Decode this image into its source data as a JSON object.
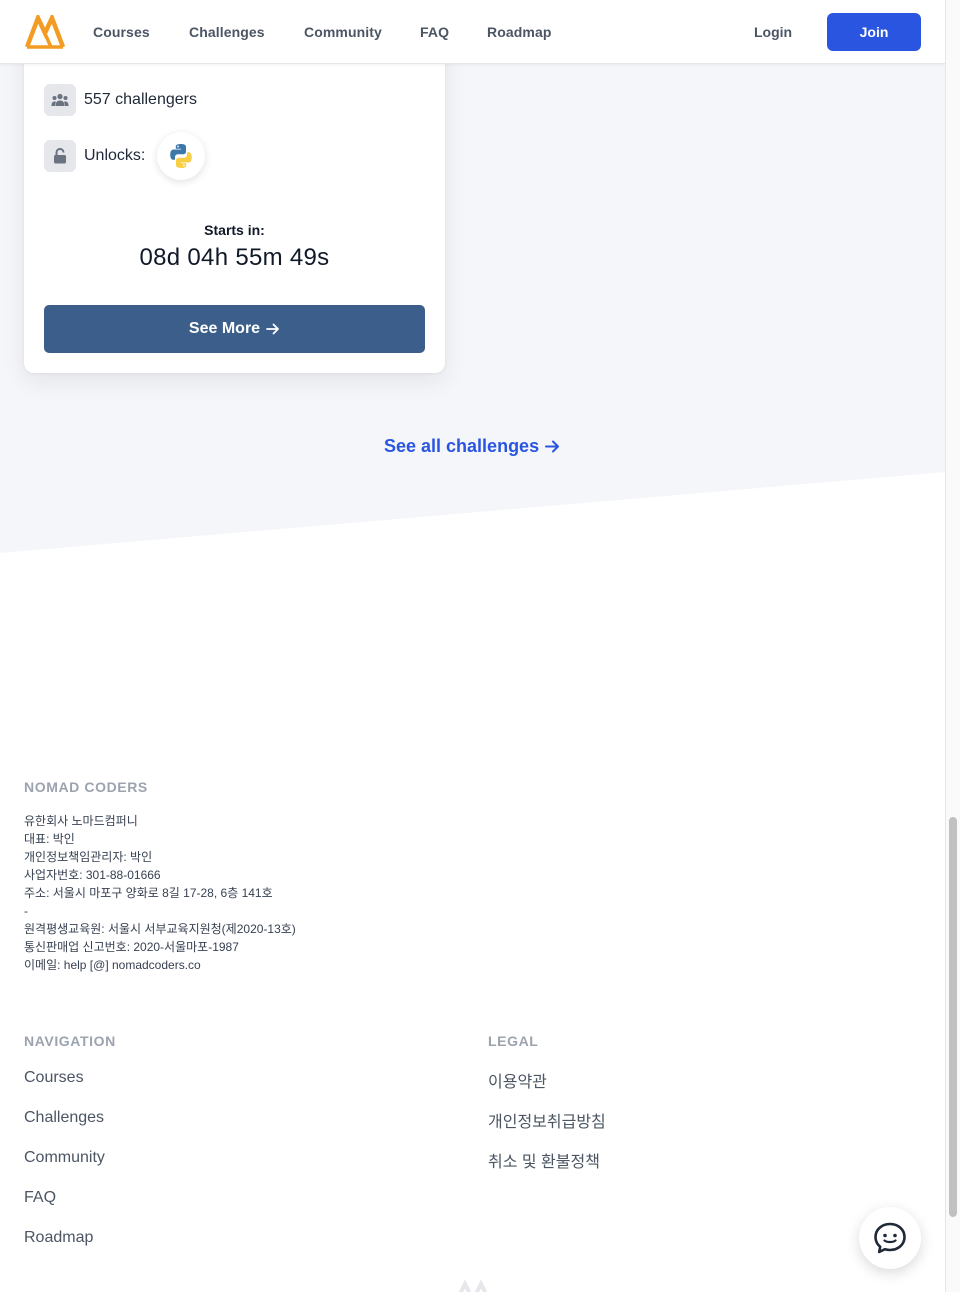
{
  "header": {
    "nav": [
      "Courses",
      "Challenges",
      "Community",
      "FAQ",
      "Roadmap"
    ],
    "login_label": "Login",
    "join_label": "Join"
  },
  "card": {
    "challengers": "557 challengers",
    "unlocks_label": "Unlocks:",
    "starts_label": "Starts in:",
    "countdown": "08d 04h 55m 49s",
    "see_more_label": "See More"
  },
  "see_all_label": "See all challenges",
  "footer": {
    "brand_title": "NOMAD CODERS",
    "company_lines": [
      "유한회사 노마드컴퍼니",
      "대표: 박인",
      "개인정보책임관리자: 박인",
      "사업자번호: 301-88-01666",
      "주소: 서울시 마포구 양화로 8길 17-28, 6층 141호",
      "-",
      "원격평생교육원: 서울시 서부교육지원청(제2020-13호)",
      "통신판매업 신고번호: 2020-서울마포-1987",
      "이메일: help [@] nomadcoders.co"
    ],
    "navigation_title": "NAVIGATION",
    "navigation_links": [
      "Courses",
      "Challenges",
      "Community",
      "FAQ",
      "Roadmap"
    ],
    "legal_title": "LEGAL",
    "legal_links": [
      "이용약관",
      "개인정보취급방침",
      "취소 및 환불정책"
    ]
  },
  "colors": {
    "primary": "#2a55e0",
    "button_dark": "#3b5f8a",
    "logo_orange": "#f39c23",
    "section_gray": "#f5f6f9"
  },
  "icons": [
    "nomad-logo-icon",
    "users-icon",
    "unlock-icon",
    "python-icon",
    "arrow-right-icon",
    "chat-bubble-icon"
  ]
}
